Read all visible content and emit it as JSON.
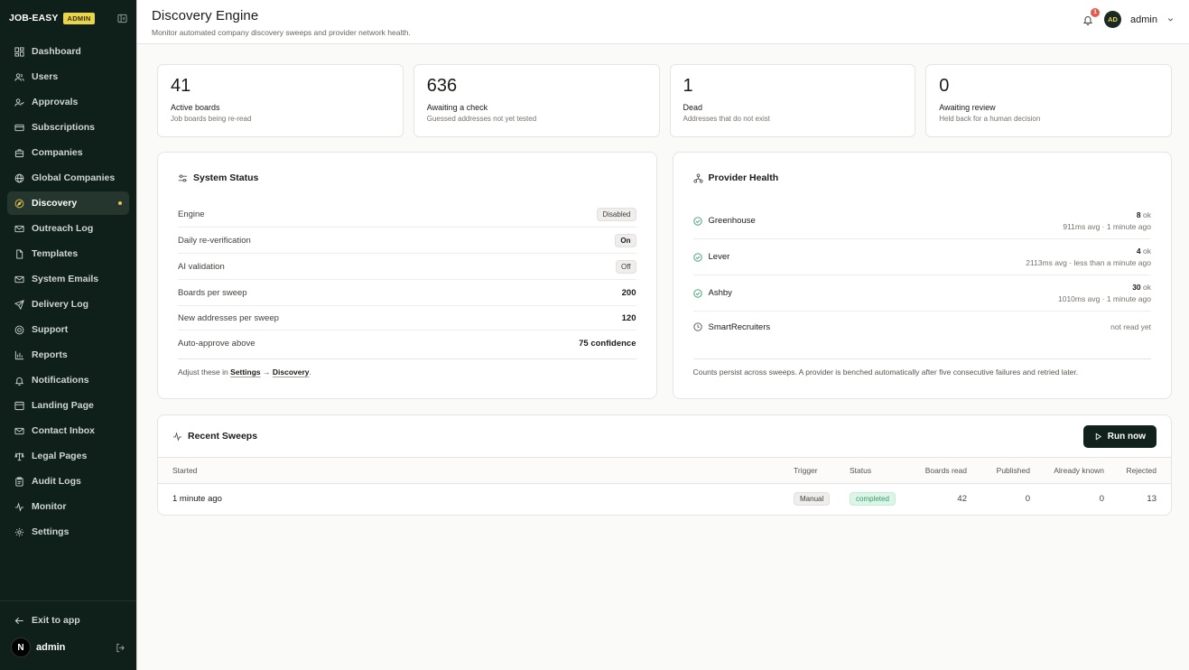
{
  "brand": {
    "name": "JOB-EASY",
    "badge": "ADMIN"
  },
  "sidebar": {
    "items": [
      {
        "label": "Dashboard",
        "icon": "dashboard-icon"
      },
      {
        "label": "Users",
        "icon": "users-icon"
      },
      {
        "label": "Approvals",
        "icon": "user-check-icon"
      },
      {
        "label": "Subscriptions",
        "icon": "credit-card-icon"
      },
      {
        "label": "Companies",
        "icon": "building-icon"
      },
      {
        "label": "Global Companies",
        "icon": "globe-icon"
      },
      {
        "label": "Discovery",
        "icon": "compass-icon",
        "active": true
      },
      {
        "label": "Outreach Log",
        "icon": "mail-icon"
      },
      {
        "label": "Templates",
        "icon": "file-icon"
      },
      {
        "label": "System Emails",
        "icon": "mail-icon"
      },
      {
        "label": "Delivery Log",
        "icon": "send-icon"
      },
      {
        "label": "Support",
        "icon": "life-buoy-icon"
      },
      {
        "label": "Reports",
        "icon": "bar-chart-icon"
      },
      {
        "label": "Notifications",
        "icon": "bell-icon"
      },
      {
        "label": "Landing Page",
        "icon": "layout-icon"
      },
      {
        "label": "Contact Inbox",
        "icon": "inbox-icon"
      },
      {
        "label": "Legal Pages",
        "icon": "scale-icon"
      },
      {
        "label": "Audit Logs",
        "icon": "clipboard-icon"
      },
      {
        "label": "Monitor",
        "icon": "activity-icon"
      },
      {
        "label": "Settings",
        "icon": "gear-icon"
      }
    ],
    "exit_label": "Exit to app",
    "user": {
      "initial": "N",
      "name": "admin"
    }
  },
  "header": {
    "title": "Discovery Engine",
    "subtitle": "Monitor automated company discovery sweeps and provider network health.",
    "notification_count": "1",
    "avatar_initials": "AD",
    "user_name": "admin"
  },
  "stats": [
    {
      "value": "41",
      "label": "Active boards",
      "sub": "Job boards being re-read"
    },
    {
      "value": "636",
      "label": "Awaiting a check",
      "sub": "Guessed addresses not yet tested"
    },
    {
      "value": "1",
      "label": "Dead",
      "sub": "Addresses that do not exist"
    },
    {
      "value": "0",
      "label": "Awaiting review",
      "sub": "Held back for a human decision"
    }
  ],
  "system_status": {
    "title": "System Status",
    "rows": [
      {
        "label": "Engine",
        "value": "Disabled",
        "kind": "pill"
      },
      {
        "label": "Daily re-verification",
        "value": "On",
        "kind": "pill-on"
      },
      {
        "label": "AI validation",
        "value": "Off",
        "kind": "pill"
      },
      {
        "label": "Boards per sweep",
        "value": "200",
        "kind": "text"
      },
      {
        "label": "New addresses per sweep",
        "value": "120",
        "kind": "text"
      },
      {
        "label": "Auto-approve above",
        "value": "75 confidence",
        "kind": "text"
      }
    ],
    "footer_prefix": "Adjust these in ",
    "footer_link_a": "Settings",
    "footer_arrow": " → ",
    "footer_link_b": "Discovery",
    "footer_suffix": "."
  },
  "provider_health": {
    "title": "Provider Health",
    "providers": [
      {
        "name": "Greenhouse",
        "count": "8",
        "count_suffix": " ok",
        "meta": "911ms avg · 1 minute ago",
        "status": "ok"
      },
      {
        "name": "Lever",
        "count": "4",
        "count_suffix": " ok",
        "meta": "2113ms avg · less than a minute ago",
        "status": "ok"
      },
      {
        "name": "Ashby",
        "count": "30",
        "count_suffix": " ok",
        "meta": "1010ms avg · 1 minute ago",
        "status": "ok"
      },
      {
        "name": "SmartRecruiters",
        "count": "",
        "count_suffix": "",
        "meta": "not read yet",
        "status": "pending"
      }
    ],
    "footer": "Counts persist across sweeps. A provider is benched automatically after five consecutive failures and retried later."
  },
  "recent_sweeps": {
    "title": "Recent Sweeps",
    "run_label": "Run now",
    "columns": [
      "Started",
      "Trigger",
      "Status",
      "Boards read",
      "Published",
      "Already known",
      "Rejected"
    ],
    "rows": [
      {
        "started": "1 minute ago",
        "trigger": "Manual",
        "status": "completed",
        "boards_read": "42",
        "published": "0",
        "already_known": "0",
        "rejected": "13"
      }
    ]
  },
  "colors": {
    "sidebar_bg": "#0f1f19",
    "accent_yellow": "#e8d44d",
    "ok_green": "#3a9a6a",
    "primary_button": "#10221b",
    "badge_red": "#e15a4f"
  }
}
